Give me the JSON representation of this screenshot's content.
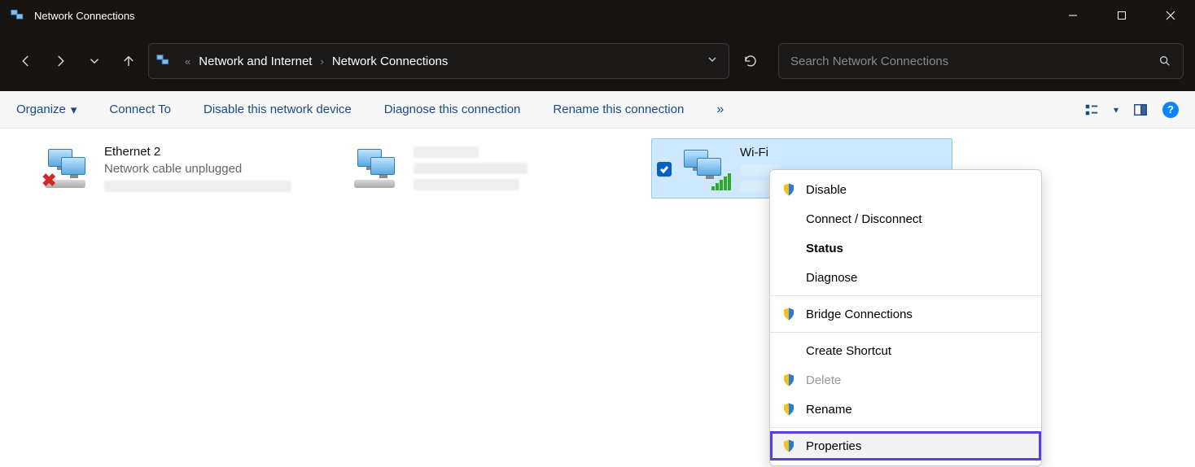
{
  "window": {
    "title": "Network Connections"
  },
  "breadcrumb": {
    "seg1": "Network and Internet",
    "seg2": "Network Connections"
  },
  "search": {
    "placeholder": "Search Network Connections"
  },
  "toolbar": {
    "organize": "Organize",
    "connect_to": "Connect To",
    "disable": "Disable this network device",
    "diagnose": "Diagnose this connection",
    "rename": "Rename this connection"
  },
  "adapters": [
    {
      "name": "Ethernet 2",
      "status": "Network cable unplugged"
    },
    {
      "name": "",
      "status": ""
    },
    {
      "name": "Wi-Fi",
      "status": ""
    }
  ],
  "context_menu": {
    "disable": "Disable",
    "connect": "Connect / Disconnect",
    "status": "Status",
    "diagnose": "Diagnose",
    "bridge": "Bridge Connections",
    "shortcut": "Create Shortcut",
    "delete": "Delete",
    "rename": "Rename",
    "properties": "Properties"
  },
  "help_glyph": "?"
}
